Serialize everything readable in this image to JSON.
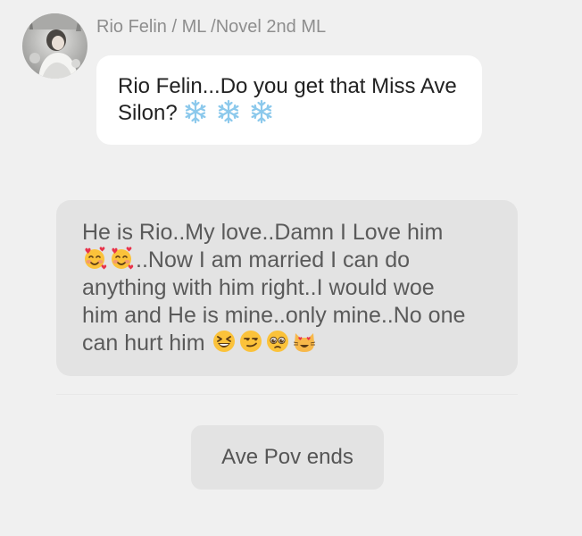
{
  "sender": {
    "name": "Rio Felin / ML /Novel 2nd ML"
  },
  "message": {
    "text": "Rio Felin...Do you get that Miss Ave Silon?",
    "emojis": [
      "snowflake-icon",
      "snowflake-icon",
      "snowflake-icon"
    ]
  },
  "narration": {
    "line1": "He is Rio..My love..Damn I Love him",
    "line2": "..Now I am married I can do",
    "line3": "anything with him right..I would woe",
    "line4": "him and He is mine..only mine..No one",
    "line5": "can hurt him",
    "line2_emojis": [
      "smiling-face-with-hearts-icon",
      "smiling-face-with-hearts-icon"
    ],
    "line5_emojis": [
      "grinning-squinting-face-icon",
      "smirking-face-icon",
      "pleading-face-icon",
      "heart-eyes-cat-icon"
    ]
  },
  "pov_marker": {
    "label": "Ave Pov ends"
  },
  "colors": {
    "background": "#f0f0f0",
    "message_bubble": "#ffffff",
    "narration_bubble": "#e3e3e3",
    "snowflake": "#8cc9ec"
  }
}
